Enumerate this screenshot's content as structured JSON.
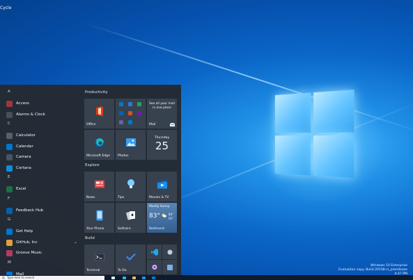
{
  "desktop": {
    "icon_label": "Cycle"
  },
  "start_menu": {
    "apps": [
      {
        "type": "letter",
        "text": "A"
      },
      {
        "type": "app",
        "label": "Access",
        "color": "#a4373a"
      },
      {
        "type": "app",
        "label": "Alarms & Clock",
        "color": "#4b4f56"
      },
      {
        "type": "letter",
        "text": "C"
      },
      {
        "type": "app",
        "label": "Calculator",
        "color": "#5a6068"
      },
      {
        "type": "app",
        "label": "Calendar",
        "color": "#0078d4"
      },
      {
        "type": "app",
        "label": "Camera",
        "color": "#4b5563"
      },
      {
        "type": "app",
        "label": "Cortana",
        "color": "#0f8fe0"
      },
      {
        "type": "letter",
        "text": "E"
      },
      {
        "type": "app",
        "label": "Excel",
        "color": "#1e7145"
      },
      {
        "type": "letter",
        "text": "F"
      },
      {
        "type": "app",
        "label": "Feedback Hub",
        "color": "#0063b1"
      },
      {
        "type": "letter",
        "text": "G"
      },
      {
        "type": "app",
        "label": "Get Help",
        "color": "#0078d4"
      },
      {
        "type": "app",
        "label": "GitHub, Inc",
        "color": "#e8a33b",
        "chevron": "⌄"
      },
      {
        "type": "app",
        "label": "Groove Music",
        "color": "#b83b5e"
      },
      {
        "type": "letter",
        "text": "M"
      },
      {
        "type": "app",
        "label": "Mail",
        "color": "#0078d4"
      }
    ],
    "groups": {
      "productivity": "Productivity",
      "explore": "Explore",
      "build": "Build"
    },
    "tiles": {
      "office": "Office",
      "mail_promo": "See all your mail in one place",
      "mail": "Mail",
      "edge": "Microsoft Edge",
      "photos": "Photos",
      "calendar_day": "Thursday",
      "calendar_date": "25",
      "news": "News",
      "tips": "Tips",
      "movies": "Movies & TV",
      "phone": "Your Phone",
      "solitaire": "Solitaire",
      "weather_condition": "Mostly Sunny",
      "weather_temp": "83°",
      "weather_high": "84°",
      "weather_low": "60°",
      "weather_city": "Redmond",
      "terminal": "Terminal",
      "todo": "To Do"
    }
  },
  "taskbar": {
    "search_placeholder": "Type here to search"
  },
  "watermark": {
    "line1": "Windows 10 Enterprise",
    "line2": "Evaluation copy. Build 20158.rs_prerelease",
    "line3": "4:47 PM"
  }
}
